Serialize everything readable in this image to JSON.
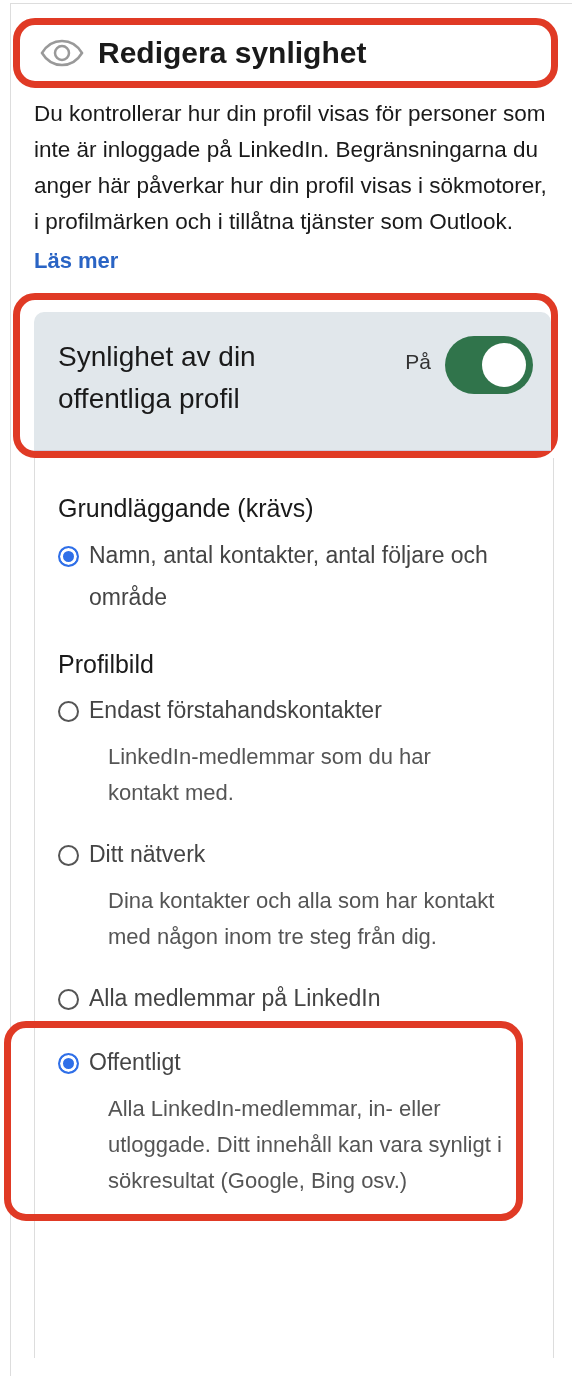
{
  "header": {
    "title": "Redigera synlighet",
    "highlighted": true
  },
  "description": "Du kontrollerar hur din profil visas för personer som inte är inloggade på LinkedIn. Begränsningarna du anger här påverkar hur din profil visas i sökmotorer, i profilmärken och i tillåtna tjänster som Outlook.",
  "link": "Läs mer",
  "visibility": {
    "title": "Synlighet av din offentliga profil",
    "state_label": "På",
    "on": true,
    "highlighted": true
  },
  "sections": [
    {
      "title": "Grundläggande (krävs)",
      "options": [
        {
          "label": "Namn, antal kontakter, antal följare och område",
          "selected": true,
          "highlighted": false
        }
      ]
    },
    {
      "title": "Profilbild",
      "options": [
        {
          "label": "Endast förstahandskontakter",
          "description": "LinkedIn-medlemmar som du har kontakt med.",
          "selected": false,
          "highlighted": false
        },
        {
          "label": "Ditt nätverk",
          "description": "Dina kontakter och alla som har kontakt med någon inom tre steg från dig.",
          "selected": false,
          "highlighted": false
        },
        {
          "label": "Alla medlemmar på LinkedIn",
          "selected": false,
          "highlighted": false
        },
        {
          "label": "Offentligt",
          "description": "Alla LinkedIn-medlemmar, in- eller utloggade. Ditt innehåll kan vara synligt i sökresultat (Google, Bing osv.)",
          "selected": true,
          "highlighted": true
        }
      ]
    }
  ]
}
